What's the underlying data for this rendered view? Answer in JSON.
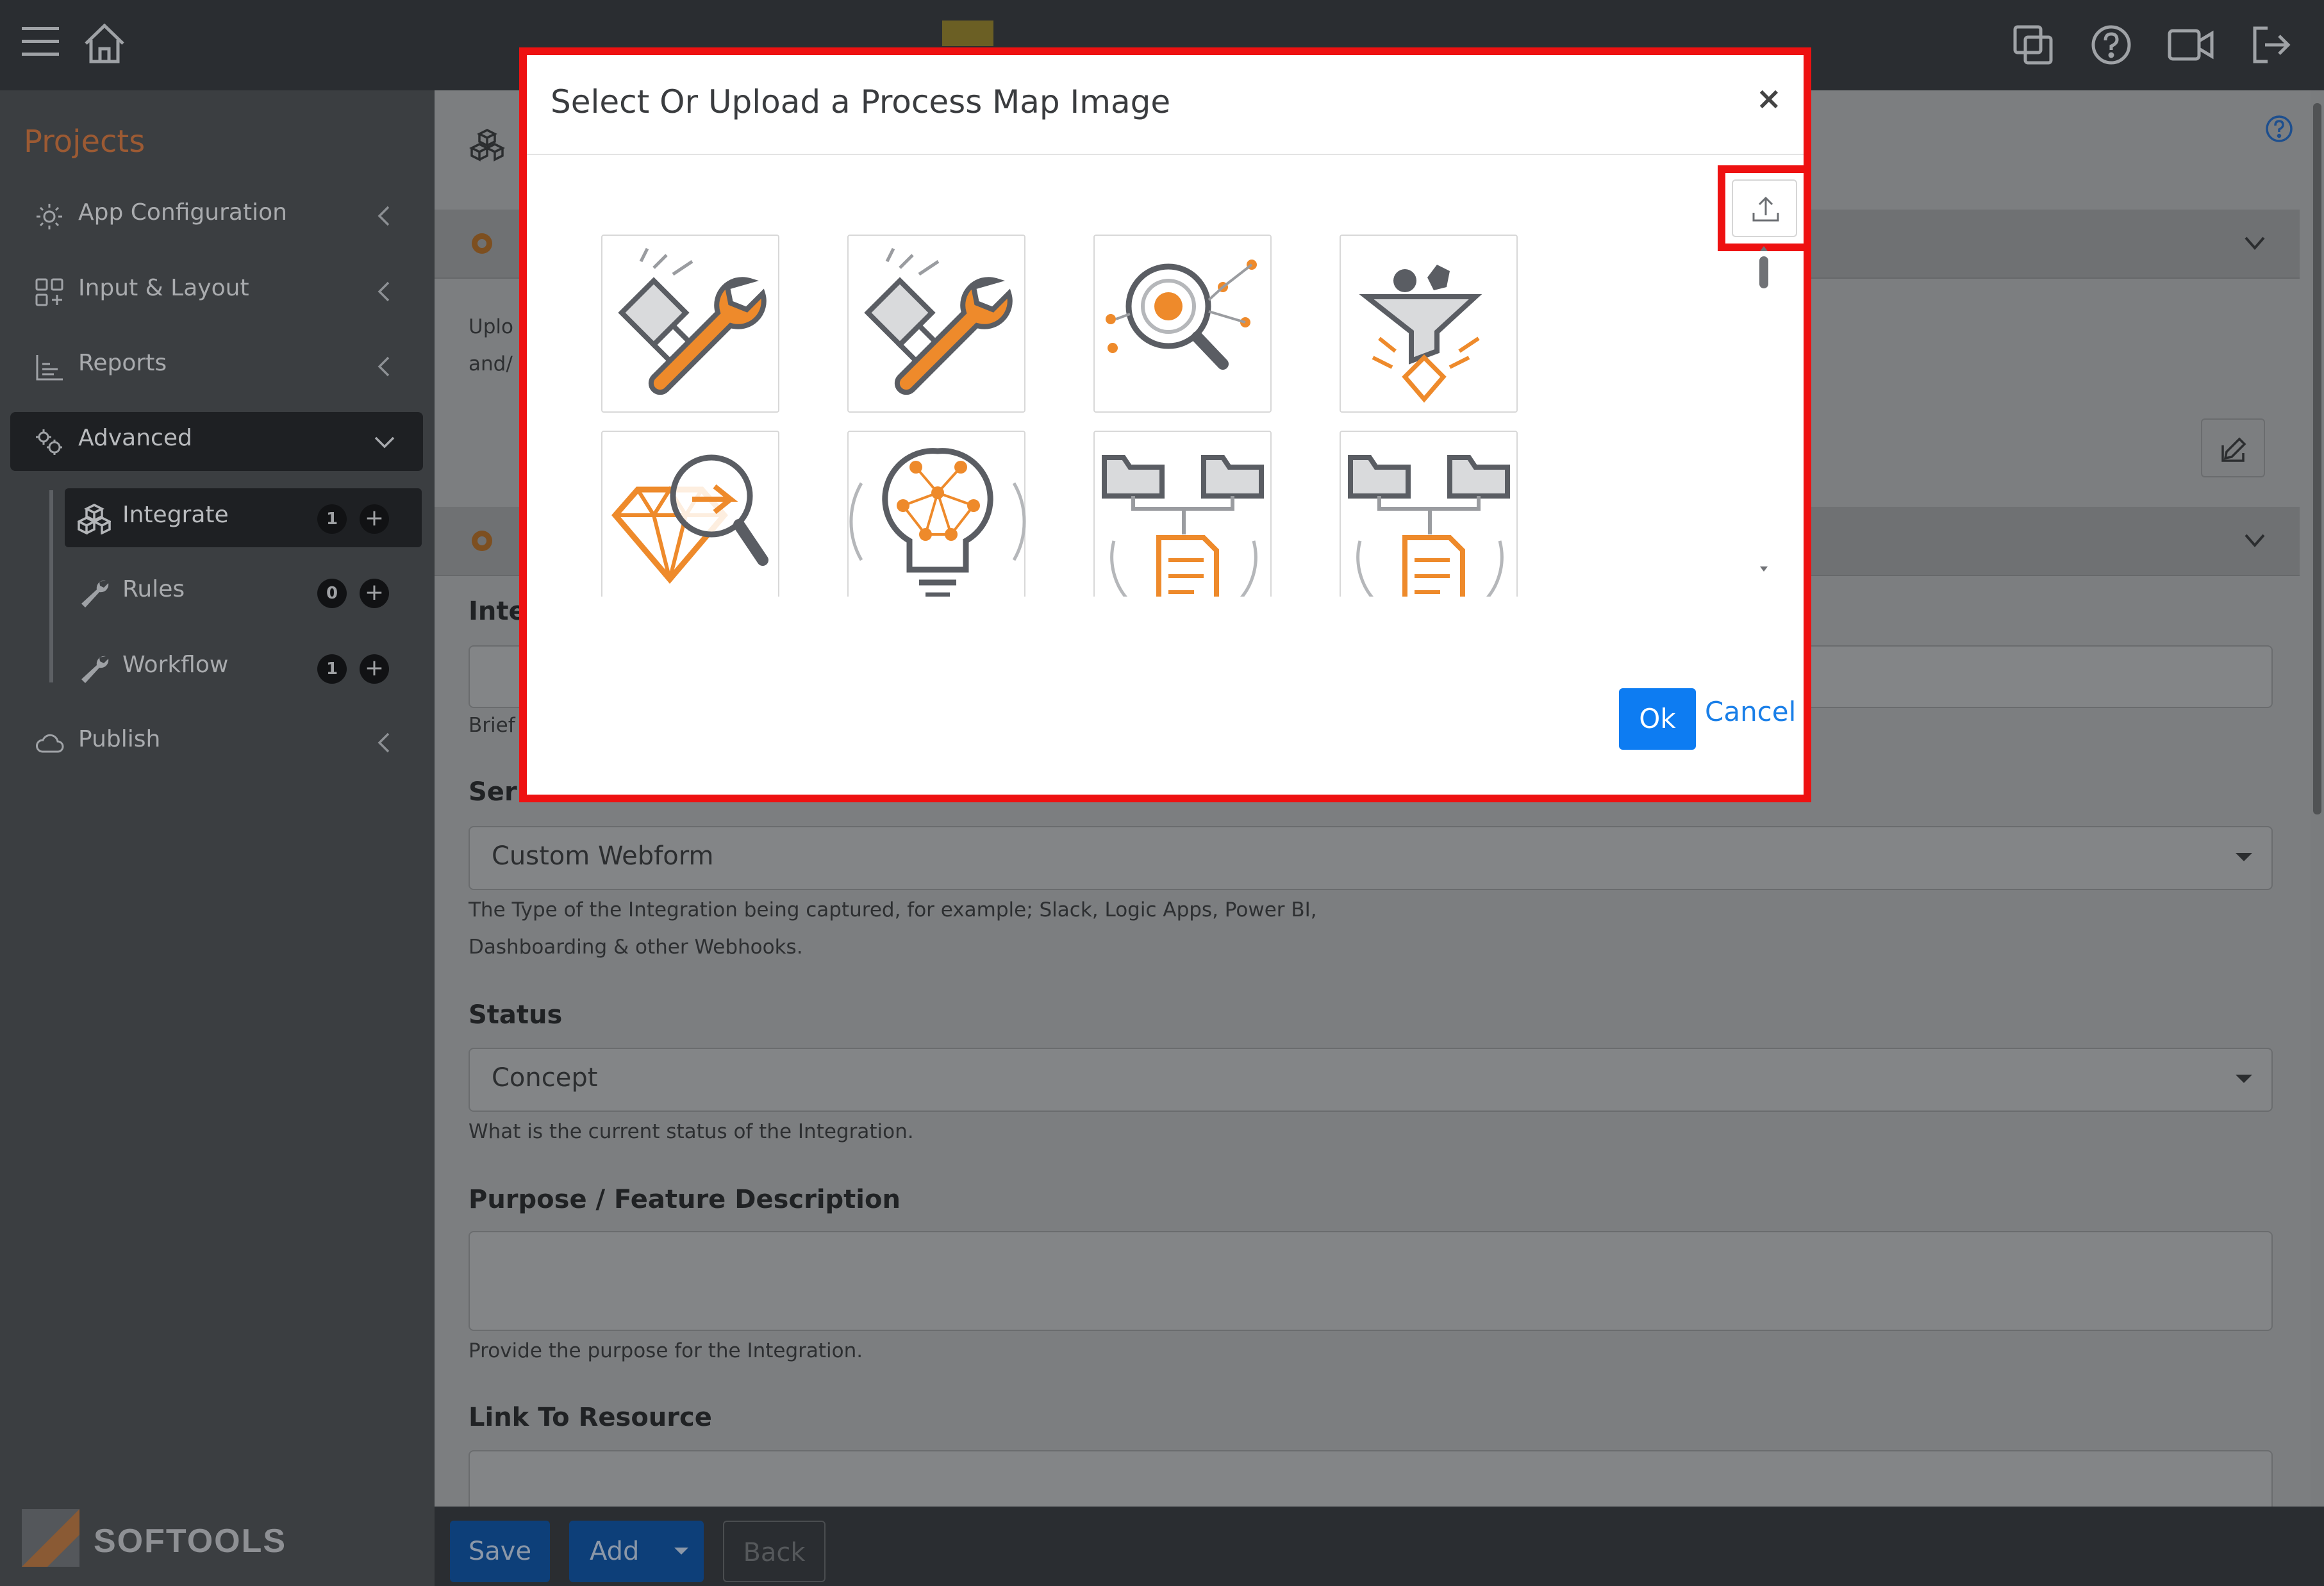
{
  "sidebar": {
    "section_title": "Projects",
    "items": [
      {
        "label": "App Configuration",
        "icon": "gear-icon"
      },
      {
        "label": "Input & Layout",
        "icon": "layout-grid-icon"
      },
      {
        "label": "Reports",
        "icon": "bar-chart-icon"
      },
      {
        "label": "Advanced",
        "icon": "gears-icon"
      },
      {
        "label": "Publish",
        "icon": "cloud-icon"
      }
    ],
    "subitems": [
      {
        "label": "Integrate",
        "count": "1",
        "icon": "cubes-icon"
      },
      {
        "label": "Rules",
        "count": "0",
        "icon": "wrench-icon"
      },
      {
        "label": "Workflow",
        "count": "1",
        "icon": "wrench-icon"
      }
    ],
    "brand": "SOFTOOLS"
  },
  "main": {
    "partial_text_1": "Uplo",
    "partial_text_2": "and/",
    "section_label_1": "Inte",
    "help_brief": "Brief",
    "section_label_service": "Ser",
    "service_value": "Custom Webform",
    "service_help_1": "The Type of the Integration being captured, for example; Slack, Logic Apps, Power BI,",
    "service_help_2": "Dashboarding & other Webhooks.",
    "status_label": "Status",
    "status_value": "Concept",
    "status_help": "What is the current status of the Integration.",
    "purpose_label": "Purpose / Feature Description",
    "purpose_help": "Provide the purpose for the Integration.",
    "link_label": "Link To Resource"
  },
  "bottombar": {
    "save": "Save",
    "add": "Add",
    "back": "Back"
  },
  "modal": {
    "title": "Select Or Upload a Process Map Image",
    "close": "×",
    "ok": "Ok",
    "cancel": "Cancel",
    "thumbnails": [
      "wrench-hand-icon",
      "wrench-hand-icon",
      "magnifier-network-icon",
      "funnel-diamond-icon",
      "diamond-magnifier-icon",
      "lightbulb-network-icon",
      "folders-document-icon",
      "folders-document-icon"
    ]
  },
  "colors": {
    "accent_orange": "#ee8a2b",
    "icon_gray": "#8b8e94",
    "modal_highlight": "#ee1111",
    "primary_blue": "#0d7cf2"
  }
}
